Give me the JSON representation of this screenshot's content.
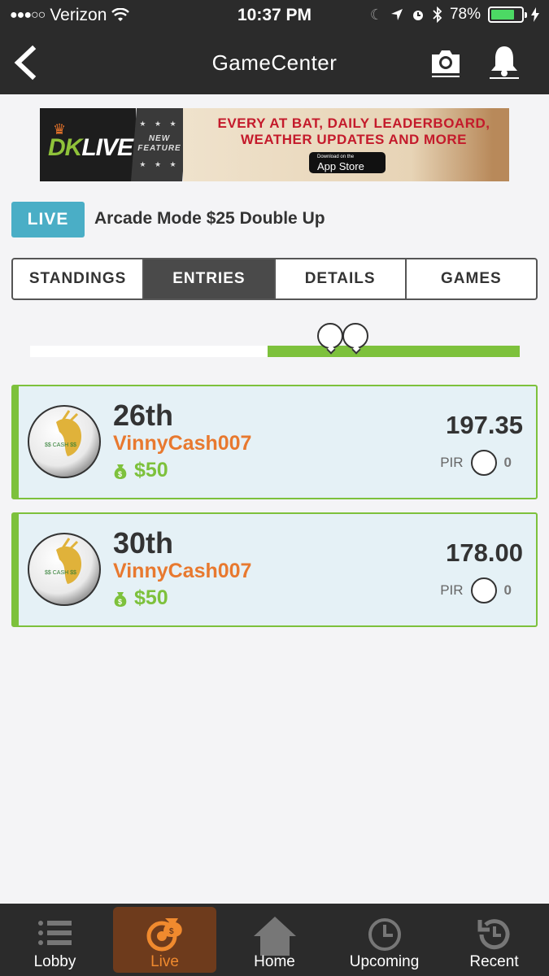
{
  "status_bar": {
    "signal": "●●●○○",
    "carrier": "Verizon",
    "time": "10:37 PM",
    "battery": "78%",
    "battery_level": 0.78
  },
  "nav": {
    "title": "GameCenter"
  },
  "banner": {
    "logo_dk": "DK",
    "logo_live": "LIVE",
    "stars": "★ ★ ★",
    "feature": "NEW\nFEATURE",
    "headline": "EVERY AT BAT, DAILY LEADERBOARD, WEATHER UPDATES AND MORE",
    "store_small": "Download on the",
    "store_big": "App Store"
  },
  "contest": {
    "badge": "LIVE",
    "title": "Arcade Mode $25 Double Up"
  },
  "tabs": [
    "STANDINGS",
    "ENTRIES",
    "DETAILS",
    "GAMES"
  ],
  "active_tab": "ENTRIES",
  "progress": {
    "payout_line_fraction": 0.485
  },
  "entries": [
    {
      "rank": "26th",
      "username": "VinnyCash007",
      "winnings": "$50",
      "score": "197.35",
      "pir_label": "PIR",
      "pir_value": "0"
    },
    {
      "rank": "30th",
      "username": "VinnyCash007",
      "winnings": "$50",
      "score": "178.00",
      "pir_label": "PIR",
      "pir_value": "0"
    }
  ],
  "bottom_nav": [
    {
      "label": "Lobby",
      "icon": "lobby-list-icon"
    },
    {
      "label": "Live",
      "icon": "live-money-icon"
    },
    {
      "label": "Home",
      "icon": "home-icon"
    },
    {
      "label": "Upcoming",
      "icon": "clock-icon"
    },
    {
      "label": "Recent",
      "icon": "history-icon"
    }
  ],
  "colors": {
    "accent_green": "#7dc13c",
    "username_orange": "#e8792f",
    "live_blue": "#4aaec6",
    "bar_dark": "#2b2b2b"
  }
}
